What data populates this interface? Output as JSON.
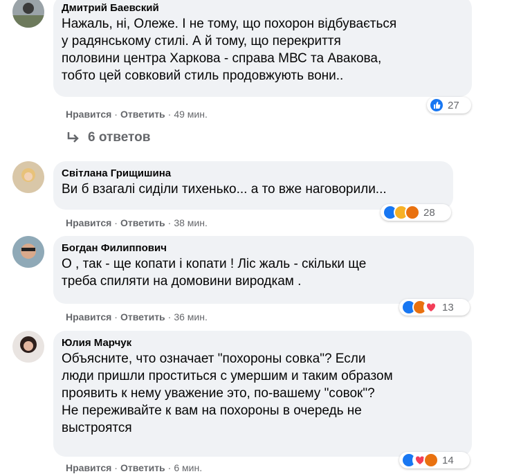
{
  "comments": [
    {
      "author": "Дмитрий Баевский",
      "text": "Нажаль, ні, Олеже. І не тому, що похорон відбувається\nу радянському стилі. А й тому, що перекриття\nполовини центра Харкова - справа МВС та Авакова,\nтобто цей совковий стиль продовжують вони..",
      "like_label": "Нравится",
      "reply_label": "Ответить",
      "time": "49 мин.",
      "reactions_count": "27",
      "reactions": [
        "like"
      ]
    },
    {
      "author": "Світлана Грищишина",
      "text": "Ви б взагалі сиділи тихенько... а то вже наговорили...",
      "like_label": "Нравится",
      "reply_label": "Ответить",
      "time": "38 мин.",
      "reactions_count": "28",
      "reactions": [
        "like",
        "haha",
        "angry"
      ]
    },
    {
      "author": "Богдан Филиппович",
      "text": "О , так - ще копати і копати ! Ліс жаль - скільки ще\nтреба спиляти на домовини виродкам .",
      "like_label": "Нравится",
      "reply_label": "Ответить",
      "time": "36 мин.",
      "reactions_count": "13",
      "reactions": [
        "like",
        "angry",
        "love"
      ]
    },
    {
      "author": "Юлия Марчук",
      "text": "Объясните, что означает \"похороны совка\"? Если\nлюди пришли проститься с умершим и таким образом\nпроявить к нему уважение это, по-вашему \"совок\"?\nНе переживайте к вам на похороны в очередь не\nвыстроятся",
      "like_label": "Нравится",
      "reply_label": "Ответить",
      "time": "6 мин.",
      "reactions_count": "14",
      "reactions": [
        "like",
        "love",
        "angry"
      ]
    }
  ],
  "replies_toggle": {
    "label": "6 ответов"
  },
  "colors": {
    "bubble": "#f0f2f5",
    "like": "#1877f2",
    "haha": "#f7b125",
    "angry": "#e9710f",
    "love": "#f33e58",
    "meta": "#65676b"
  }
}
